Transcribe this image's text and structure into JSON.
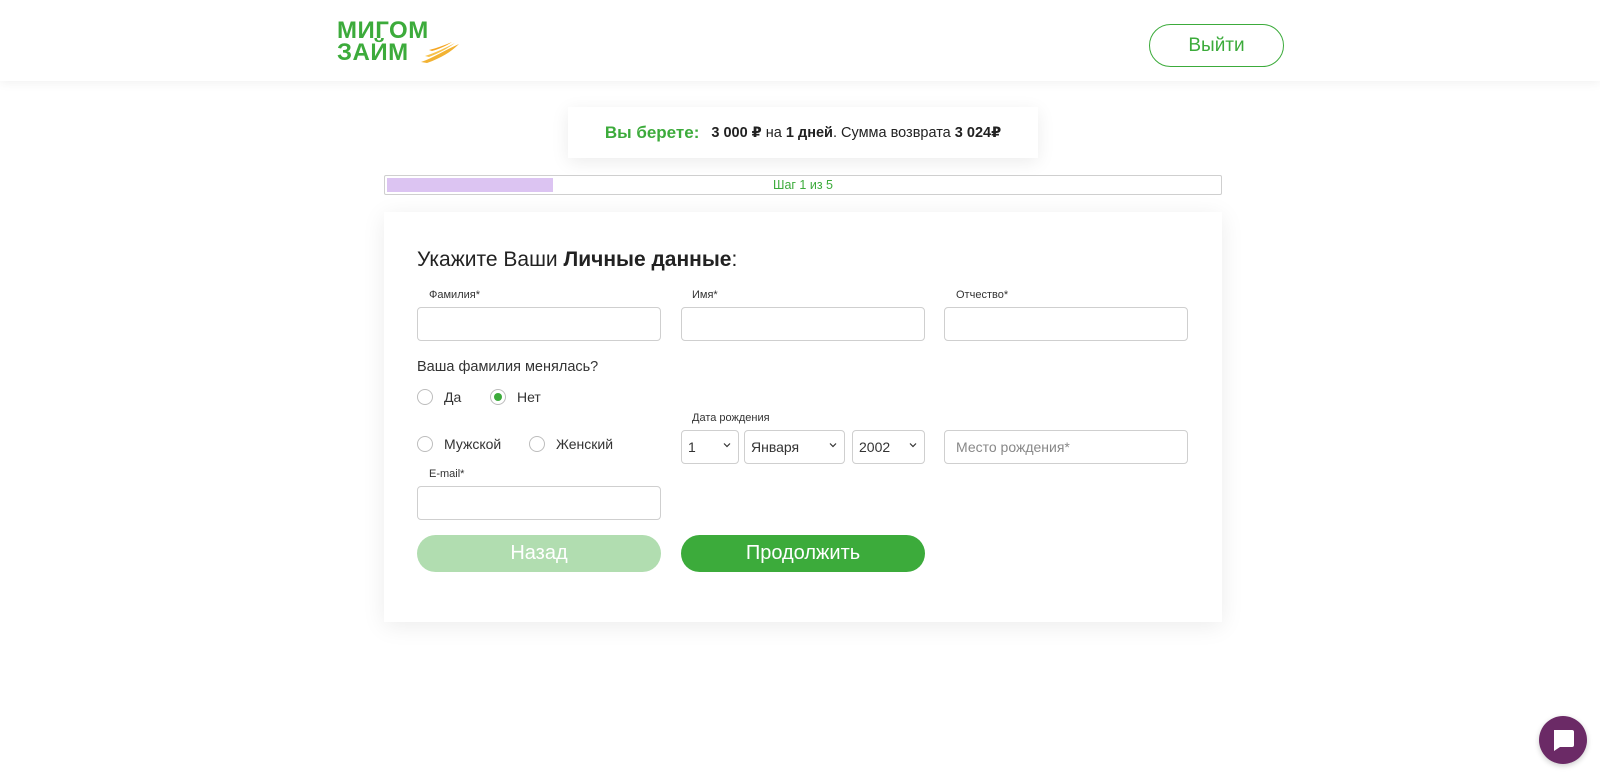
{
  "header": {
    "logo_line1": "МИГОМ",
    "logo_line2": "ЗАЙМ",
    "logout_label": "Выйти"
  },
  "summary": {
    "lead": "Вы берете:",
    "amount": "3 000 ₽",
    "text_on": " на ",
    "days": "1 дней",
    "text_return": ". Сумма возврата ",
    "return_amount": "3 024₽"
  },
  "progress": {
    "label": "Шаг 1 из 5",
    "fraction": 0.2
  },
  "form": {
    "heading_prefix": "Укажите Ваши ",
    "heading_bold": "Личные данные",
    "heading_suffix": ":",
    "surname_label": "Фамилия*",
    "surname_value": "",
    "name_label": "Имя*",
    "name_value": "",
    "patronymic_label": "Отчество*",
    "patronymic_value": "",
    "surname_changed_question": "Ваша фамилия менялась?",
    "option_yes": "Да",
    "option_no": "Нет",
    "surname_changed_selected": "Нет",
    "gender_male": "Мужской",
    "gender_female": "Женский",
    "birthdate_label": "Дата рождения",
    "birth_day": "1",
    "birth_month": "Января",
    "birth_year": "2002",
    "birthplace_placeholder": "Место рождения*",
    "email_label": "E-mail*",
    "email_value": "",
    "back_label": "Назад",
    "next_label": "Продолжить"
  },
  "colors": {
    "brand_green": "#3cab3b",
    "progress_fill": "#dcc4f2",
    "chat_purple": "#6b2a66"
  },
  "icons": {
    "logo": "migom-zaim-logo",
    "chevron": "chevron-down-icon",
    "chat": "chat-bubble-icon"
  }
}
